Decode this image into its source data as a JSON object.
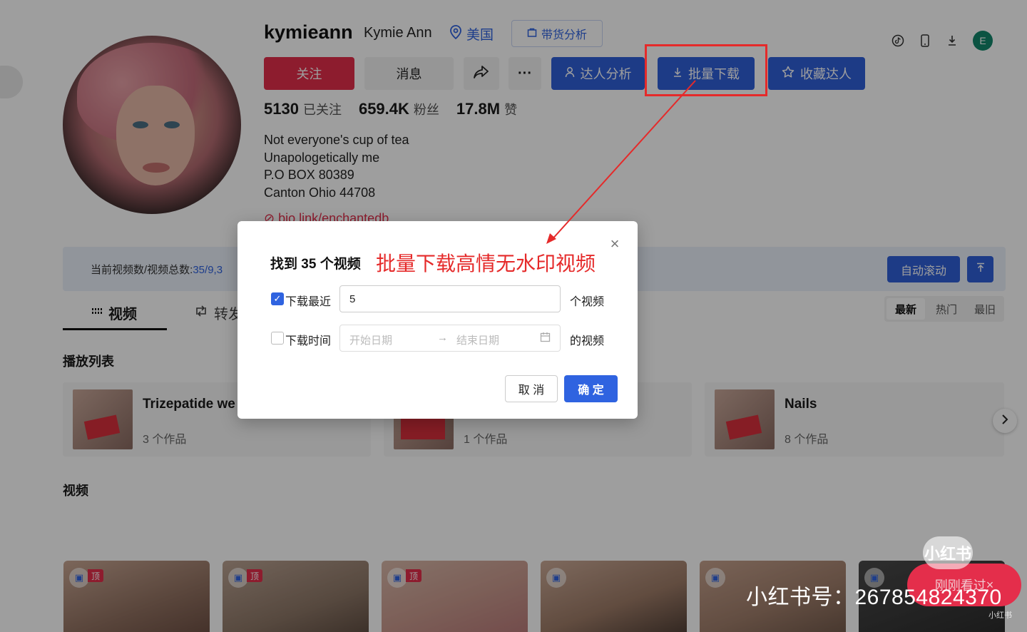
{
  "profile": {
    "username": "kymieann",
    "nickname": "Kymie Ann",
    "location": "美国",
    "sales_analysis_label": "带货分析",
    "follow_label": "关注",
    "message_label": "消息",
    "more_label": "···",
    "influencer_analysis_label": "达人分析",
    "batch_download_label": "批量下载",
    "favorite_label": "收藏达人",
    "stats": [
      {
        "value": "5130",
        "label": "已关注"
      },
      {
        "value": "659.4K",
        "label": "粉丝"
      },
      {
        "value": "17.8M",
        "label": "赞"
      }
    ],
    "bio": [
      "Not everyone's cup of tea",
      "Unapologetically me",
      "P.O BOX 80389",
      "Canton Ohio 44708"
    ],
    "bio_link": "bio.link/enchantedb",
    "user_initial": "E"
  },
  "infobar": {
    "text": "当前视频数/视频总数:",
    "count": "35/9,3",
    "auto_scroll_label": "自动滚动",
    "to_top_label": "↑"
  },
  "sort": [
    "最新",
    "热门",
    "最旧"
  ],
  "tabs": {
    "videos": "视频",
    "reposts": "转发"
  },
  "sections": {
    "playlist": "播放列表",
    "videos": "视频"
  },
  "playlists": [
    {
      "title": "Trizepatide we",
      "count": "3 个作品"
    },
    {
      "title": "",
      "count": "1 个作品"
    },
    {
      "title": "Nails",
      "count": "8 个作品"
    }
  ],
  "video_pin_label": "顶",
  "modal": {
    "title": "找到 35 个视频",
    "annotation": "批量下载高情无水印视频",
    "recent_label": "下载最近",
    "recent_value": "5",
    "recent_unit": "个视频",
    "time_label": "下载时间",
    "start_placeholder": "开始日期",
    "end_placeholder": "结束日期",
    "time_unit": "的视频",
    "cancel_label": "取 消",
    "ok_label": "确 定"
  },
  "watermark": {
    "logo": "小红书",
    "recent_pill": "刚刚看过",
    "id_text": "小红书号：267854824370",
    "small": "小红书"
  },
  "colors": {
    "primary": "#2f63e0",
    "danger": "#e42e4b",
    "annotation": "#e52a2a"
  }
}
